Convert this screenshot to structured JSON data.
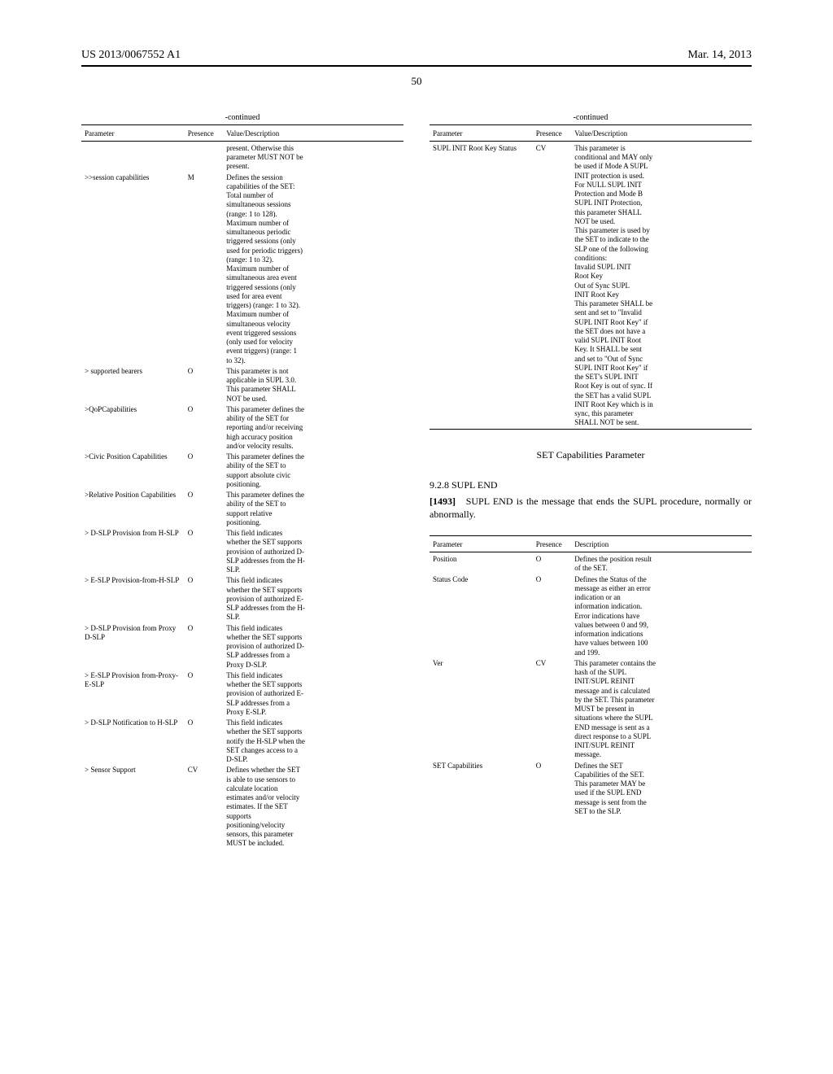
{
  "header": {
    "left": "US 2013/0067552 A1",
    "right": "Mar. 14, 2013"
  },
  "page_number": "50",
  "table_left": {
    "title": "-continued",
    "headers": [
      "Parameter",
      "Presence",
      "Value/Description"
    ],
    "rows": [
      {
        "param": "",
        "pres": "",
        "desc": [
          "present. Otherwise this",
          "parameter MUST NOT be",
          "present."
        ]
      },
      {
        "param": ">>session capabilities",
        "pres": "M",
        "desc": [
          "Defines the session",
          "capabilities of the SET:",
          "Total number of",
          "simultaneous sessions",
          "(range: 1 to 128).",
          "Maximum number of",
          "simultaneous periodic",
          "triggered sessions (only",
          "used for periodic triggers)",
          "(range: 1 to 32).",
          "Maximum number of",
          "simultaneous area event",
          "triggered sessions (only",
          "used for area event",
          "triggers) (range: 1 to 32).",
          "Maximum number of",
          "simultaneous velocity",
          "event triggered sessions",
          "(only used for velocity",
          "event triggers) (range: 1",
          "to 32)."
        ]
      },
      {
        "param": "> supported bearers",
        "pres": "O",
        "desc": [
          "This parameter is not",
          "applicable in SUPL 3.0.",
          "This parameter SHALL",
          "NOT be used."
        ]
      },
      {
        "param": ">QoPCapabilities",
        "pres": "O",
        "desc": [
          "This parameter defines the",
          "ability of the SET for",
          "reporting and/or receiving",
          "high accuracy position",
          "and/or velocity results."
        ]
      },
      {
        "param": ">Civic Position Capabilities",
        "pres": "O",
        "desc": [
          "This parameter defines the",
          "ability of the SET to",
          "support absolute civic",
          "positioning."
        ]
      },
      {
        "param": ">Relative Position Capabilities",
        "pres": "O",
        "desc": [
          "This parameter defines the",
          "ability of the SET to",
          "support relative",
          "positioning."
        ]
      },
      {
        "param": "> D-SLP Provision from H-SLP",
        "pres": "O",
        "desc": [
          "This field indicates",
          "whether the SET supports",
          "provision of authorized D-",
          "SLP addresses from the H-",
          "SLP."
        ]
      },
      {
        "param": "> E-SLP Provision-from-H-SLP",
        "pres": "O",
        "desc": [
          "This field indicates",
          "whether the SET supports",
          "provision of authorized E-",
          "SLP addresses from the H-",
          "SLP."
        ]
      },
      {
        "param": "> D-SLP Provision from Proxy D-SLP",
        "pres": "O",
        "desc": [
          "This field indicates",
          "whether the SET supports",
          "provision of authorized D-",
          "SLP addresses from a",
          "Proxy D-SLP."
        ]
      },
      {
        "param": "> E-SLP Provision from-Proxy-E-SLP",
        "pres": "O",
        "desc": [
          "This field indicates",
          "whether the SET supports",
          "provision of authorized E-",
          "SLP addresses from a",
          "Proxy E-SLP."
        ]
      },
      {
        "param": "> D-SLP Notification to H-SLP",
        "pres": "O",
        "desc": [
          "This field indicates",
          "whether the SET supports",
          "notify the H-SLP when the",
          "SET changes access to a",
          "D-SLP."
        ]
      },
      {
        "param": "> Sensor Support",
        "pres": "CV",
        "desc": [
          "Defines whether the SET",
          "is able to use sensors to",
          "calculate location",
          "estimates and/or velocity",
          "estimates. If the SET",
          "supports",
          "positioning/velocity",
          "sensors, this parameter",
          "MUST be included."
        ]
      }
    ]
  },
  "table_right_top": {
    "title": "-continued",
    "headers": [
      "Parameter",
      "Presence",
      "Value/Description"
    ],
    "rows": [
      {
        "param": "SUPL INIT Root Key Status",
        "pres": "CV",
        "desc": [
          "This parameter is",
          "conditional and MAY only",
          "be used if Mode A SUPL",
          "INIT protection is used.",
          "For NULL SUPL INIT",
          "Protection and Mode B",
          "SUPL INIT Protection,",
          "this parameter SHALL",
          "NOT be used.",
          "This parameter is used by",
          "the SET to indicate to the",
          "SLP one of the following",
          "conditions:",
          "Invalid SUPL INIT",
          "Root Key",
          "Out of Sync SUPL",
          "INIT Root Key",
          "This parameter SHALL be",
          "sent and set to \"Invalid",
          "SUPL INIT Root Key\" if",
          "the SET does not have a",
          "valid SUPL INIT Root",
          "Key. It SHALL be sent",
          "and set to \"Out of Sync",
          "SUPL INIT Root Key\" if",
          "the SET's SUPL INIT",
          "Root Key is out of sync. If",
          "the SET has a valid SUPL",
          "INIT Root Key which is in",
          "sync, this parameter",
          "SHALL NOT be sent."
        ]
      }
    ]
  },
  "caption": "SET Capabilities Parameter",
  "section2": {
    "num": "9.2.8",
    "title": "SUPL END"
  },
  "para": {
    "num": "[1493]",
    "text": "SUPL END is the message that ends the SUPL procedure, normally or abnormally."
  },
  "table_right_bottom": {
    "headers": [
      "Parameter",
      "Presence",
      "Description"
    ],
    "rows": [
      {
        "param": "Position",
        "pres": "O",
        "desc": [
          "Defines the position result",
          "of the SET."
        ]
      },
      {
        "param": "Status Code",
        "pres": "O",
        "desc": [
          "Defines the Status of the",
          "message as either an error",
          "indication or an",
          "information indication.",
          "Error indications have",
          "values between 0 and 99,",
          "information indications",
          "have values between 100",
          "and 199."
        ]
      },
      {
        "param": "Ver",
        "pres": "CV",
        "desc": [
          "This parameter contains the",
          "hash of the SUPL",
          "INIT/SUPL REINIT",
          "message and is calculated",
          "by the SET. This parameter",
          "MUST be present in",
          "situations where the SUPL",
          "END message is sent as a",
          "direct response to a SUPL",
          "INIT/SUPL REINIT",
          "message."
        ]
      },
      {
        "param": "SET Capabilities",
        "pres": "O",
        "desc": [
          "Defines the SET",
          "Capabilities of the SET.",
          "This parameter MAY be",
          "used if the SUPL END",
          "message is sent from the",
          "SET to the SLP."
        ]
      }
    ]
  }
}
